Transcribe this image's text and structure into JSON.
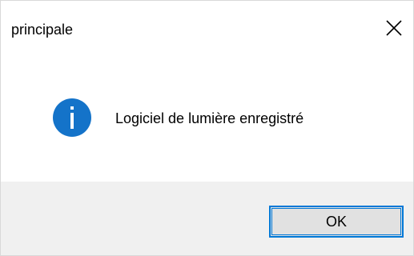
{
  "window": {
    "title": "principale",
    "close_icon": "close-icon"
  },
  "content": {
    "icon": "info-icon",
    "message": "Logiciel de lumière enregistré"
  },
  "footer": {
    "ok_label": "OK"
  },
  "colors": {
    "info_blue": "#1473c9",
    "accent": "#0078d7",
    "footer_bg": "#f0f0f0",
    "button_bg": "#e1e1e1"
  }
}
